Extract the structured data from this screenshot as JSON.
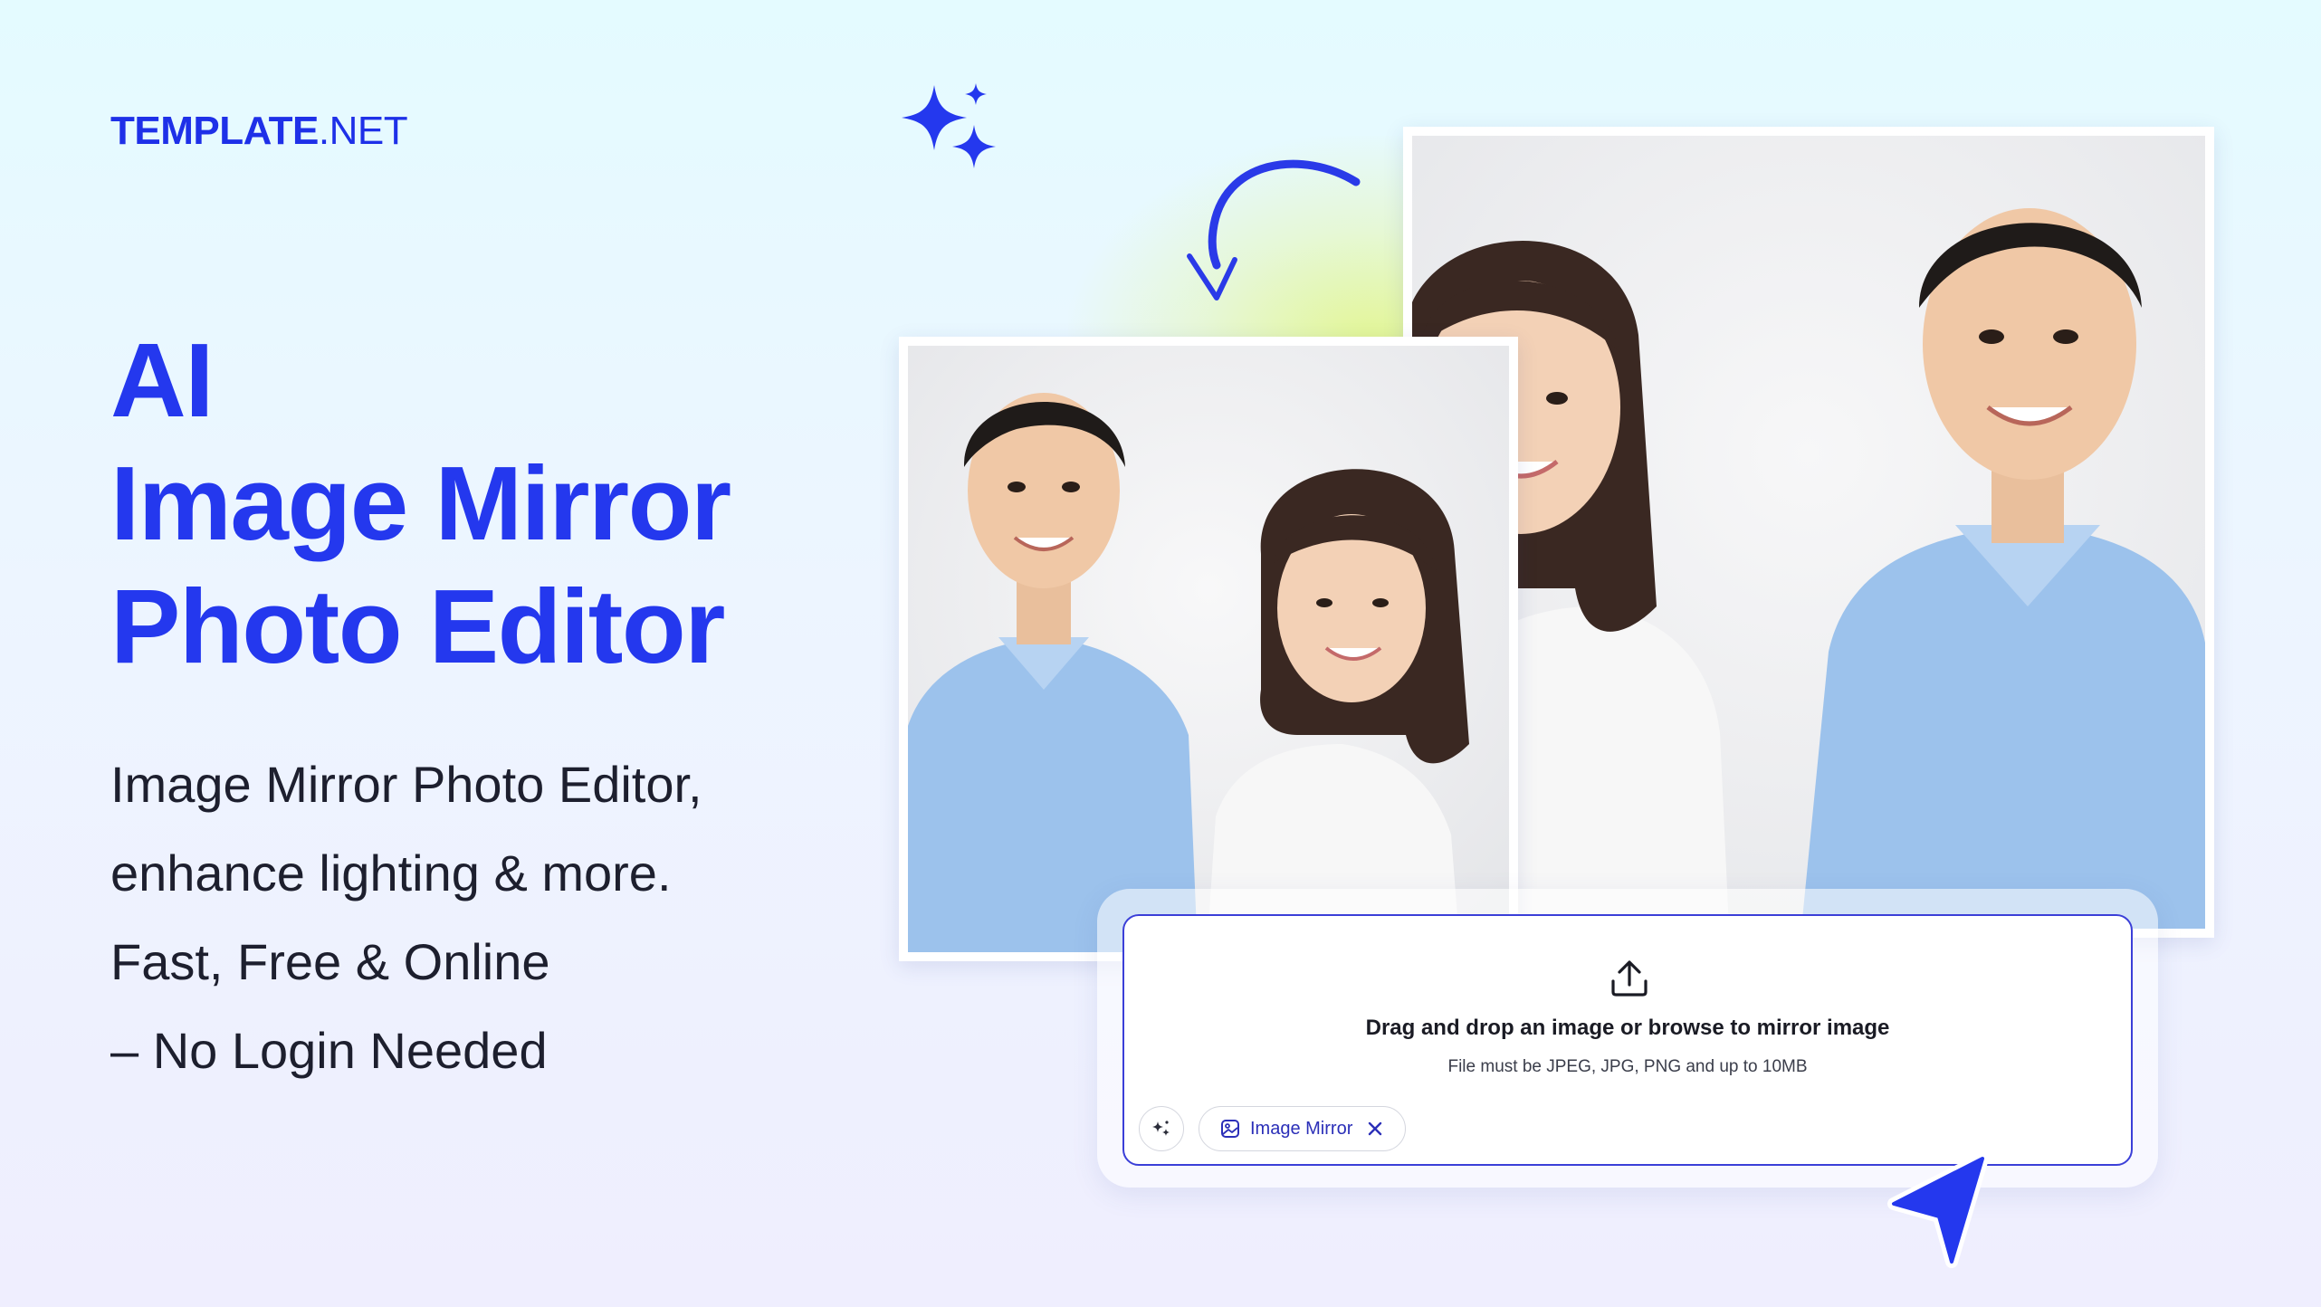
{
  "brand": {
    "name_bold": "TEMPLATE",
    "name_light": ".NET",
    "color": "#1e30e8"
  },
  "hero": {
    "line1": "AI",
    "line2": "Image Mirror",
    "line3": "Photo Editor",
    "color": "#2438ee"
  },
  "description": {
    "line1": "Image Mirror Photo Editor,",
    "line2": "enhance lighting & more.",
    "line3": "Fast, Free & Online",
    "line4": "– No Login Needed"
  },
  "uploader": {
    "title": "Drag and drop an image or browse to mirror image",
    "subtitle": "File must be JPEG, JPG, PNG and up to 10MB",
    "chip_label": "Image Mirror",
    "border_color": "#3b3fd8"
  },
  "icons": {
    "sparkles": "sparkles-icon",
    "curved_arrow": "curved-arrow-icon",
    "upload": "upload-icon",
    "magic": "magic-wand-icon",
    "chip_image": "image-icon",
    "chip_close": "close-icon",
    "cursor": "cursor-pointer-icon"
  },
  "colors": {
    "accent": "#2438ee",
    "shirt_blue": "#9cc2ec",
    "background_top": "#e4fbff",
    "background_bottom": "#efeefe"
  }
}
